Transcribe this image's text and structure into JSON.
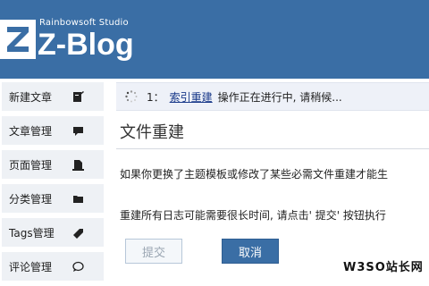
{
  "header": {
    "brand_sub": "Rainbowsoft Studio",
    "brand_main": "Z-Blog",
    "bg_color": "#3a6ea5"
  },
  "sidebar": {
    "items": [
      {
        "label": "新建文章",
        "icon": "edit-doc-icon"
      },
      {
        "label": "文章管理",
        "icon": "comment-bubble-icon"
      },
      {
        "label": "页面管理",
        "icon": "page-icon"
      },
      {
        "label": "分类管理",
        "icon": "folder-icon"
      },
      {
        "label": "Tags管理",
        "icon": "tag-icon"
      },
      {
        "label": "评论管理",
        "icon": "comment-icon"
      }
    ]
  },
  "notice": {
    "number": "1：",
    "link": "索引重建",
    "message": "操作正在进行中, 请稍候..."
  },
  "main": {
    "title": "文件重建",
    "para1": "如果你更换了主题模板或修改了某些必需文件重建才能生",
    "para2": "重建所有日志可能需要很长时间, 请点击' 提交' 按钮执行"
  },
  "buttons": {
    "submit": "提交",
    "cancel": "取消"
  },
  "watermark": "W3SO站长网"
}
